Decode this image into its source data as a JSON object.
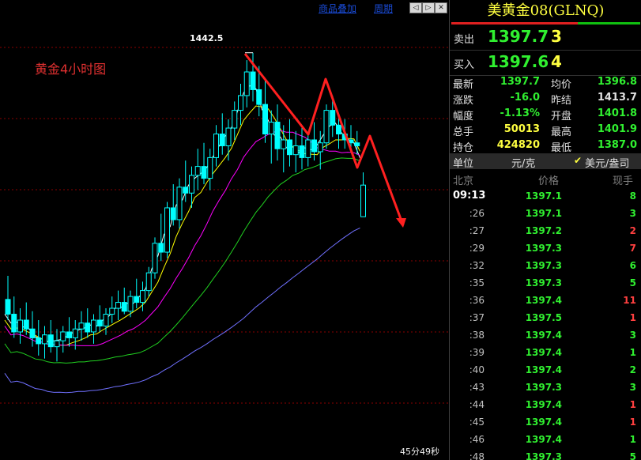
{
  "toolbar": {
    "overlay_label": "商品叠加",
    "period_label": "周期",
    "btn_left": "◁",
    "btn_right": "▷",
    "btn_close": "✕"
  },
  "chart": {
    "title": "黄金4小时图",
    "peak_label": "1442.5",
    "timer": "45分49秒",
    "colors": {
      "up": "#00ffff",
      "down": "#00ffff",
      "ma1": "#ffffff",
      "ma2": "#ffff00",
      "ma3": "#ff00ff",
      "ma4": "#20d020",
      "ma5": "#7070ff",
      "grid": "#8b0000",
      "arrow": "#ff2020"
    }
  },
  "chart_data": {
    "type": "candlestick",
    "title": "黄金4小时图",
    "annotations": [
      "1442.5"
    ],
    "candles": [
      [
        1359,
        1367,
        1352,
        1354
      ],
      [
        1354,
        1360,
        1346,
        1348
      ],
      [
        1348,
        1356,
        1344,
        1352
      ],
      [
        1352,
        1358,
        1347,
        1349
      ],
      [
        1349,
        1355,
        1343,
        1346
      ],
      [
        1346,
        1352,
        1340,
        1344
      ],
      [
        1344,
        1350,
        1339,
        1347
      ],
      [
        1347,
        1352,
        1341,
        1343
      ],
      [
        1343,
        1349,
        1338,
        1345
      ],
      [
        1345,
        1350,
        1341,
        1348
      ],
      [
        1348,
        1353,
        1343,
        1346
      ],
      [
        1346,
        1352,
        1342,
        1349
      ],
      [
        1349,
        1355,
        1345,
        1351
      ],
      [
        1351,
        1356,
        1346,
        1348
      ],
      [
        1348,
        1354,
        1344,
        1352
      ],
      [
        1352,
        1357,
        1348,
        1350
      ],
      [
        1350,
        1356,
        1347,
        1354
      ],
      [
        1354,
        1360,
        1351,
        1356
      ],
      [
        1356,
        1362,
        1352,
        1358
      ],
      [
        1358,
        1363,
        1354,
        1355
      ],
      [
        1355,
        1362,
        1353,
        1360
      ],
      [
        1360,
        1366,
        1356,
        1358
      ],
      [
        1358,
        1365,
        1355,
        1362
      ],
      [
        1362,
        1370,
        1360,
        1368
      ],
      [
        1368,
        1380,
        1366,
        1378
      ],
      [
        1378,
        1388,
        1372,
        1375
      ],
      [
        1375,
        1392,
        1373,
        1390
      ],
      [
        1390,
        1398,
        1384,
        1386
      ],
      [
        1386,
        1400,
        1383,
        1397
      ],
      [
        1397,
        1406,
        1392,
        1395
      ],
      [
        1395,
        1404,
        1390,
        1401
      ],
      [
        1401,
        1410,
        1396,
        1404
      ],
      [
        1404,
        1412,
        1398,
        1400
      ],
      [
        1400,
        1410,
        1396,
        1407
      ],
      [
        1407,
        1418,
        1404,
        1415
      ],
      [
        1415,
        1422,
        1408,
        1411
      ],
      [
        1411,
        1420,
        1406,
        1417
      ],
      [
        1417,
        1426,
        1413,
        1423
      ],
      [
        1423,
        1432,
        1418,
        1428
      ],
      [
        1428,
        1440,
        1424,
        1436
      ],
      [
        1436,
        1442.5,
        1426,
        1430
      ],
      [
        1430,
        1438,
        1421,
        1425
      ],
      [
        1425,
        1434,
        1412,
        1415
      ],
      [
        1415,
        1423,
        1405,
        1419
      ],
      [
        1419,
        1425,
        1406,
        1410
      ],
      [
        1410,
        1418,
        1402,
        1413
      ],
      [
        1413,
        1420,
        1404,
        1408
      ],
      [
        1408,
        1416,
        1402,
        1411
      ],
      [
        1411,
        1417,
        1403,
        1407
      ],
      [
        1407,
        1415,
        1404,
        1413
      ],
      [
        1413,
        1419,
        1406,
        1409
      ],
      [
        1409,
        1416,
        1403,
        1412
      ],
      [
        1412,
        1425,
        1410,
        1423
      ],
      [
        1423,
        1428,
        1414,
        1418
      ],
      [
        1418,
        1422,
        1410,
        1415
      ],
      [
        1415,
        1420,
        1410,
        1413
      ],
      [
        1413,
        1418,
        1409,
        1412
      ],
      [
        1412,
        1416,
        1408,
        1411
      ],
      [
        1387,
        1402,
        1387,
        1397.7
      ]
    ]
  },
  "quote": {
    "title": "美黄金08(GLNQ)",
    "ask": {
      "label": "卖出",
      "price": "1397.7",
      "vol": "3"
    },
    "bid": {
      "label": "买入",
      "price": "1397.6",
      "vol": "4"
    },
    "stats": [
      {
        "k1": "最新",
        "v1": "1397.7",
        "c1": "g",
        "k2": "均价",
        "v2": "1396.8",
        "c2": "g"
      },
      {
        "k1": "涨跌",
        "v1": "-16.0",
        "c1": "g",
        "k2": "昨结",
        "v2": "1413.7",
        "c2": "w"
      },
      {
        "k1": "幅度",
        "v1": "-1.13%",
        "c1": "g",
        "k2": "开盘",
        "v2": "1401.8",
        "c2": "g"
      },
      {
        "k1": "总手",
        "v1": "50013",
        "c1": "y",
        "k2": "最高",
        "v2": "1401.9",
        "c2": "g"
      },
      {
        "k1": "持仓",
        "v1": "424820",
        "c1": "y",
        "k2": "最低",
        "v2": "1387.0",
        "c2": "g"
      }
    ],
    "unit": {
      "label": "单位",
      "value": "元/克",
      "check": "✔",
      "currency": "美元/盎司"
    },
    "ticks_header": {
      "place": "北京",
      "price": "价格",
      "qty": "现手"
    },
    "ticks": [
      {
        "t": "09:13",
        "p": "1397.1",
        "q": "8",
        "c": "g"
      },
      {
        "t": ":26",
        "p": "1397.1",
        "q": "3",
        "c": "g"
      },
      {
        "t": ":27",
        "p": "1397.2",
        "q": "2",
        "c": "r"
      },
      {
        "t": ":29",
        "p": "1397.3",
        "q": "7",
        "c": "r"
      },
      {
        "t": ":32",
        "p": "1397.3",
        "q": "6",
        "c": "g"
      },
      {
        "t": ":35",
        "p": "1397.3",
        "q": "5",
        "c": "g"
      },
      {
        "t": ":36",
        "p": "1397.4",
        "q": "11",
        "c": "r"
      },
      {
        "t": ":37",
        "p": "1397.5",
        "q": "1",
        "c": "r"
      },
      {
        "t": ":38",
        "p": "1397.4",
        "q": "3",
        "c": "g"
      },
      {
        "t": ":39",
        "p": "1397.4",
        "q": "1",
        "c": "g"
      },
      {
        "t": ":40",
        "p": "1397.4",
        "q": "2",
        "c": "g"
      },
      {
        "t": ":43",
        "p": "1397.3",
        "q": "3",
        "c": "g"
      },
      {
        "t": ":44",
        "p": "1397.4",
        "q": "1",
        "c": "r"
      },
      {
        "t": ":45",
        "p": "1397.4",
        "q": "1",
        "c": "r"
      },
      {
        "t": ":46",
        "p": "1397.4",
        "q": "1",
        "c": "g"
      },
      {
        "t": ":48",
        "p": "1397.3",
        "q": "5",
        "c": "g"
      }
    ]
  }
}
